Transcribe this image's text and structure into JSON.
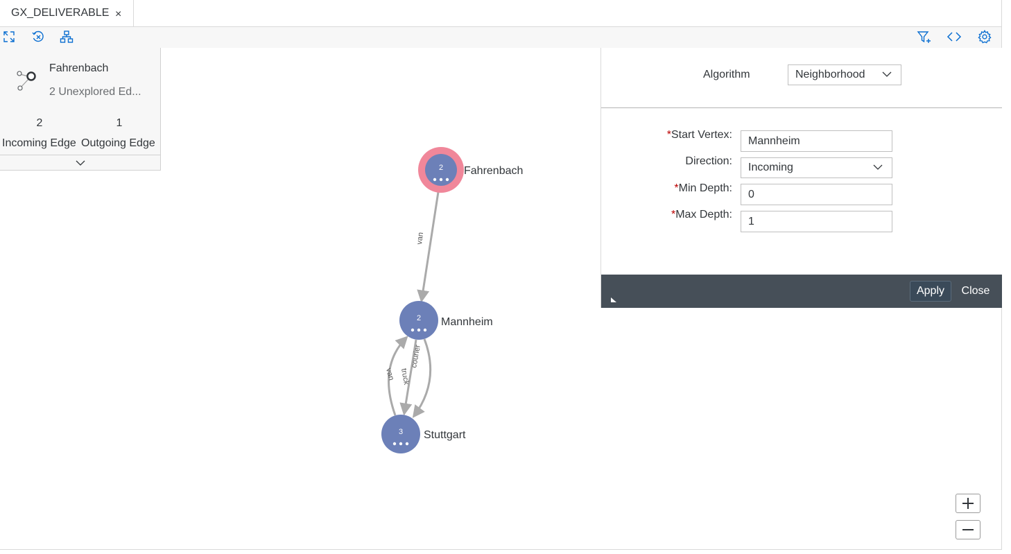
{
  "tab": {
    "title": "GX_DELIVERABLE",
    "close": "×"
  },
  "toolbar": {
    "left_icons": [
      "fit-screen-icon",
      "clear-icon",
      "layout-icon"
    ],
    "right_icons": [
      "filter-add-icon",
      "code-icon",
      "settings-icon"
    ]
  },
  "info_card": {
    "title": "Fahrenbach",
    "subtitle": "2 Unexplored Ed...",
    "incoming_count": "2",
    "incoming_label": "Incoming Edge",
    "outgoing_count": "1",
    "outgoing_label": "Outgoing Edge"
  },
  "graph": {
    "nodes": [
      {
        "id": "fahrenbach",
        "label": "Fahrenbach",
        "count": "2",
        "selected": true
      },
      {
        "id": "mannheim",
        "label": "Mannheim",
        "count": "2",
        "selected": false
      },
      {
        "id": "stuttgart",
        "label": "Stuttgart",
        "count": "3",
        "selected": false
      }
    ],
    "edges": [
      {
        "from": "fahrenbach",
        "to": "mannheim",
        "label": "van"
      },
      {
        "from": "stuttgart",
        "to": "mannheim",
        "label": "van"
      },
      {
        "from": "mannheim",
        "to": "stuttgart",
        "label": "truck"
      },
      {
        "from": "mannheim",
        "to": "stuttgart",
        "label": "courier"
      }
    ],
    "colors": {
      "node": "#6c80b8",
      "selected_ring": "#f0879a",
      "edge": "#aaaaaa"
    }
  },
  "panel": {
    "algorithm_label": "Algorithm",
    "algorithm_value": "Neighborhood",
    "start_vertex_label": "Start Vertex:",
    "start_vertex_value": "Mannheim",
    "direction_label": "Direction:",
    "direction_value": "Incoming",
    "min_depth_label": "Min Depth:",
    "min_depth_value": "0",
    "max_depth_label": "Max Depth:",
    "max_depth_value": "1",
    "required_mark": "*",
    "apply_label": "Apply",
    "close_label": "Close"
  },
  "zoom": {
    "in": "+",
    "out": "−"
  }
}
